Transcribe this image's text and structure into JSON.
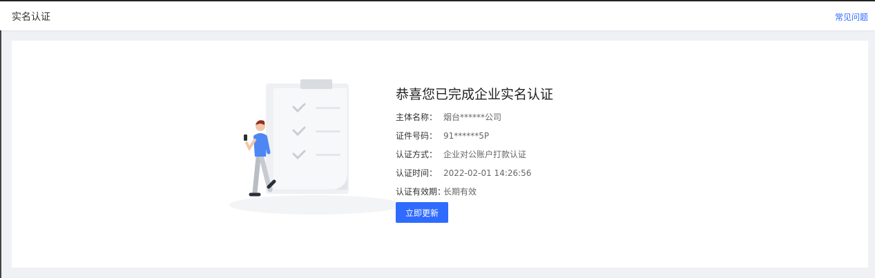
{
  "header": {
    "title": "实名认证",
    "faq_link": "常见问题"
  },
  "result": {
    "heading": "恭喜您已完成企业实名认证",
    "rows": [
      {
        "label": "主体名称：",
        "value": "烟台******公司"
      },
      {
        "label": "证件号码：",
        "value": "91******5P"
      },
      {
        "label": "认证方式：",
        "value": "企业对公账户打款认证"
      },
      {
        "label": "认证时间：",
        "value": "2022-02-01 14:26:56"
      },
      {
        "label": "认证有效期：",
        "value": "长期有效"
      }
    ],
    "update_button": "立即更新"
  },
  "colors": {
    "accent": "#2f6bff",
    "page_background": "#f0f1f5",
    "card_background": "#ffffff"
  }
}
